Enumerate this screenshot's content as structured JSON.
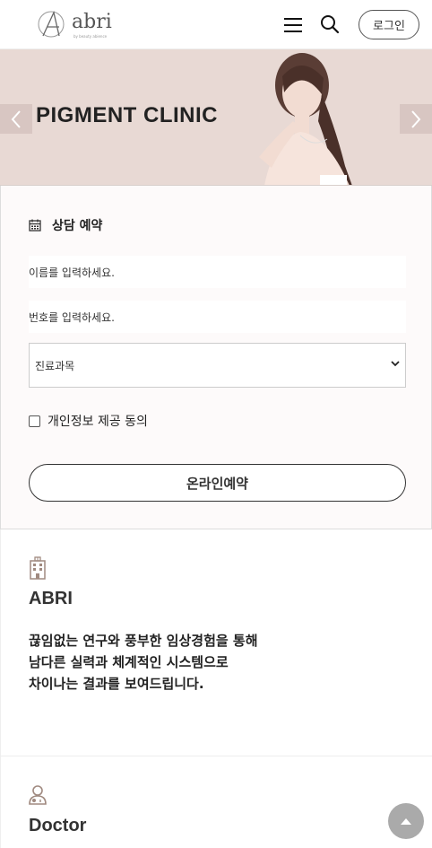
{
  "header": {
    "logo_text": "abri",
    "logo_sub": "by beauty abience",
    "login_label": "로그인"
  },
  "hero": {
    "title": "PIGMENT CLINIC"
  },
  "reservation": {
    "title": "상담 예약",
    "name_placeholder": "이름를 입력하세요.",
    "phone_placeholder": "번호를 입력하세요.",
    "department_selected": "진료과목",
    "agree_label": "개인정보 제공 동의",
    "submit_label": "온라인예약"
  },
  "sections": {
    "abri": {
      "title": "ABRI",
      "lines": [
        "끊임없는 연구와 풍부한 임상경험을 통해",
        "남다른 실력과 체계적인 시스템으로",
        "차이나는 결과를 보여드립니다."
      ]
    },
    "doctor": {
      "title": "Doctor"
    }
  },
  "colors": {
    "hero_bg": "#e8d9d4",
    "form_bg": "#fdfafa",
    "icon_brown": "#a08a80"
  }
}
